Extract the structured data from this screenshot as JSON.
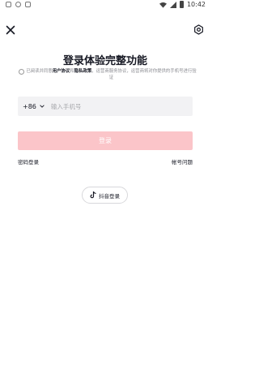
{
  "status_bar": {
    "time": "10:42"
  },
  "page": {
    "title": "登录体验完整功能"
  },
  "agreement": {
    "prefix": "已阅读并同意",
    "user_agreement": "用户协议",
    "and": "和",
    "privacy_policy": "隐私政策",
    "comma": "，运营商服务协议",
    "suffix": "，运营商将对你提供的手机号进行验证"
  },
  "phone": {
    "country_code": "+86",
    "placeholder": "输入手机号",
    "value": ""
  },
  "login_button": {
    "label": "登录"
  },
  "links": {
    "password_login": "密码登录",
    "account_problem": "帐号问题"
  },
  "third_party": {
    "douyin_label": "抖音登录"
  },
  "colors": {
    "brand_pink": "#fbc5c9",
    "input_bg": "#f2f2f4",
    "text": "#161823"
  }
}
